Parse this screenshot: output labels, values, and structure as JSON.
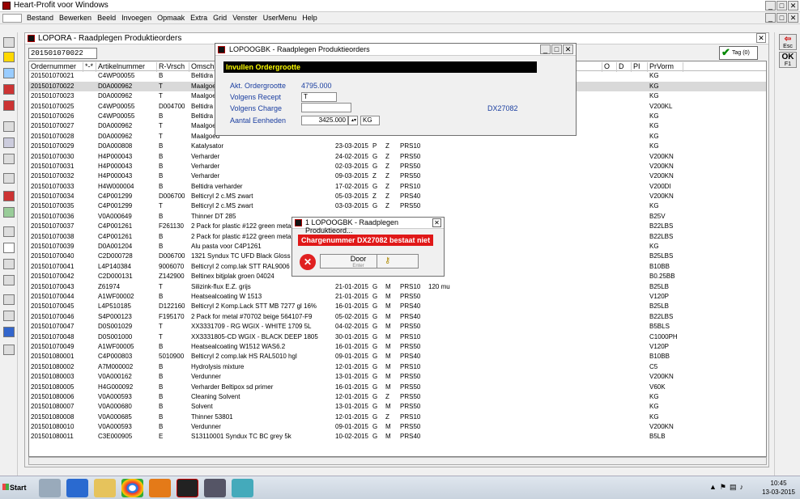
{
  "app": {
    "title": "Heart-Profit voor Windows"
  },
  "menu": [
    "Bestand",
    "Bewerken",
    "Beeld",
    "Invoegen",
    "Opmaak",
    "Extra",
    "Grid",
    "Venster",
    "UserMenu",
    "Help"
  ],
  "main": {
    "title": "LOPORA - Raadplegen Produktieorders",
    "search_value": "201501070022",
    "tag_label": "Tag (0)",
    "columns": [
      "Ordernummer",
      "*-*",
      "Artikelnummer",
      "R-Vrsch",
      "Omsch",
      "",
      "",
      "",
      "",
      "",
      "O",
      "D",
      "PI",
      "PrVorm"
    ],
    "rows": [
      [
        "201501070021",
        "",
        "C4WP00055",
        "B",
        "Beltidra 2",
        "",
        "",
        "",
        "",
        "",
        "",
        "",
        "",
        "KG"
      ],
      [
        "201501070022",
        "",
        "D0A000962",
        "T",
        "Maalgoed",
        "",
        "",
        "",
        "",
        "",
        "",
        "",
        "",
        "KG"
      ],
      [
        "201501070023",
        "",
        "D0A000962",
        "T",
        "Maalgoed",
        "",
        "",
        "",
        "",
        "",
        "",
        "",
        "",
        "KG"
      ],
      [
        "201501070025",
        "",
        "C4WP00055",
        "D004700",
        "Beltidra 2",
        "",
        "",
        "",
        "",
        "",
        "",
        "",
        "",
        "V200KL"
      ],
      [
        "201501070026",
        "",
        "C4WP00055",
        "B",
        "Beltidra 2",
        "",
        "",
        "",
        "",
        "",
        "",
        "",
        "",
        "KG"
      ],
      [
        "201501070027",
        "",
        "D0A000962",
        "T",
        "Maalgoed",
        "",
        "",
        "",
        "",
        "",
        "",
        "",
        "",
        "KG"
      ],
      [
        "201501070028",
        "",
        "D0A000962",
        "T",
        "Maalgoed",
        "",
        "",
        "",
        "",
        "",
        "",
        "",
        "",
        "KG"
      ],
      [
        "201501070029",
        "",
        "D0A000808",
        "B",
        "Katalysator",
        "23-03-2015",
        "P",
        "Z",
        "PRS10",
        "",
        "",
        "",
        "",
        "KG"
      ],
      [
        "201501070030",
        "",
        "H4P000043",
        "B",
        "Verharder",
        "24-02-2015",
        "G",
        "Z",
        "PRS50",
        "",
        "",
        "",
        "",
        "V200KN"
      ],
      [
        "201501070031",
        "",
        "H4P000043",
        "B",
        "Verharder",
        "02-03-2015",
        "G",
        "Z",
        "PRS50",
        "",
        "",
        "",
        "",
        "V200KN"
      ],
      [
        "201501070032",
        "",
        "H4P000043",
        "B",
        "Verharder",
        "09-03-2015",
        "Z",
        "Z",
        "PRS50",
        "",
        "",
        "",
        "",
        "V200KN"
      ],
      [
        "201501070033",
        "",
        "H4W000004",
        "B",
        "Beltidra verharder",
        "17-02-2015",
        "G",
        "Z",
        "PRS10",
        "",
        "",
        "",
        "",
        "V200DI"
      ],
      [
        "201501070034",
        "",
        "C4P001299",
        "D006700",
        "Belticryl 2 c.MS zwart",
        "05-03-2015",
        "Z",
        "Z",
        "PRS40",
        "",
        "",
        "",
        "",
        "V200KN"
      ],
      [
        "201501070035",
        "",
        "C4P001299",
        "T",
        "Belticryl 2 c.MS zwart",
        "03-03-2015",
        "G",
        "Z",
        "PRS50",
        "",
        "",
        "",
        "",
        "KG"
      ],
      [
        "201501070036",
        "",
        "V0A000649",
        "B",
        "Thinner DT 285",
        "",
        "",
        "",
        "",
        "",
        "",
        "",
        "",
        "B25V"
      ],
      [
        "201501070037",
        "",
        "C4P001261",
        "F261130",
        "2 Pack for plastic #122 green metal",
        "",
        "",
        "",
        "",
        "",
        "",
        "",
        "",
        "B22LBS"
      ],
      [
        "201501070038",
        "",
        "C4P001261",
        "B",
        "2 Pack for plastic #122 green metal",
        "",
        "",
        "",
        "",
        "",
        "",
        "",
        "",
        "B22LBS"
      ],
      [
        "201501070039",
        "",
        "D0A001204",
        "B",
        "Alu pasta voor C4P1261",
        "",
        "",
        "",
        "",
        "",
        "",
        "",
        "",
        "KG"
      ],
      [
        "201501070040",
        "",
        "C2D000728",
        "D006700",
        "1321 Syndux TC UFD Black Gloss 70%",
        "",
        "",
        "",
        "",
        "",
        "",
        "",
        "",
        "B25LBS"
      ],
      [
        "201501070041",
        "",
        "L4P140384",
        "9006070",
        "Belticryl 2 comp.lak STT RAL9006 gl5",
        "",
        "",
        "",
        "",
        "",
        "",
        "",
        "",
        "B10BB"
      ],
      [
        "201501070042",
        "",
        "C2D000131",
        "Z142900",
        "Beltinex bitjplak groen 04024",
        "",
        "",
        "",
        "",
        "",
        "",
        "",
        "",
        "B0.25BB"
      ],
      [
        "201501070043",
        "",
        "Z61974",
        "T",
        "Silizink-flux E.Z. grijs",
        "21-01-2015",
        "G",
        "M",
        "PRS10",
        "120 mu",
        "",
        "",
        "",
        "B25LB"
      ],
      [
        "201501070044",
        "",
        "A1WF00002",
        "B",
        "Heatsealcoating W 1513",
        "21-01-2015",
        "G",
        "M",
        "PRS50",
        "",
        "",
        "",
        "",
        "V120P"
      ],
      [
        "201501070045",
        "",
        "L4P510185",
        "D122160",
        "Belticryl 2 Komp.Lack STT MB 7277 gl 16%",
        "16-01-2015",
        "G",
        "M",
        "PRS40",
        "",
        "",
        "",
        "",
        "B25LB"
      ],
      [
        "201501070046",
        "",
        "S4P000123",
        "F195170",
        "2 Pack for metal #70702 beige 564107-F9",
        "05-02-2015",
        "G",
        "M",
        "PRS40",
        "",
        "",
        "",
        "",
        "B22LBS"
      ],
      [
        "201501070047",
        "",
        "D0S001029",
        "T",
        "XX3331709 - RG WGIX - WHITE 1709 5L",
        "04-02-2015",
        "G",
        "M",
        "PRS50",
        "",
        "",
        "",
        "",
        "B5BLS"
      ],
      [
        "201501070048",
        "",
        "D0S001000",
        "T",
        "XX3331805-CD WGIX - BLACK DEEP 1805",
        "30-01-2015",
        "G",
        "M",
        "PRS10",
        "",
        "",
        "",
        "",
        "C1000PH"
      ],
      [
        "201501070049",
        "",
        "A1WF00005",
        "B",
        "Heatsealcoating W1512 WAS6.2",
        "16-01-2015",
        "G",
        "M",
        "PRS50",
        "",
        "",
        "",
        "",
        "V120P"
      ],
      [
        "201501080001",
        "",
        "C4P000803",
        "5010900",
        "Belticryl 2 comp.lak HS RAL5010 hgl",
        "09-01-2015",
        "G",
        "M",
        "PRS40",
        "",
        "",
        "",
        "",
        "B10BB"
      ],
      [
        "201501080002",
        "",
        "A7M000002",
        "B",
        "Hydrolysis mixture",
        "12-01-2015",
        "G",
        "M",
        "PRS10",
        "",
        "",
        "",
        "",
        "C5"
      ],
      [
        "201501080003",
        "",
        "V0A000162",
        "B",
        "Verdunner",
        "13-01-2015",
        "G",
        "M",
        "PRS50",
        "",
        "",
        "",
        "",
        "V200KN"
      ],
      [
        "201501080005",
        "",
        "H4G000092",
        "B",
        "Verharder Beltipox sd primer",
        "16-01-2015",
        "G",
        "M",
        "PRS50",
        "",
        "",
        "",
        "",
        "V60K"
      ],
      [
        "201501080006",
        "",
        "V0A000593",
        "B",
        "Cleaning Solvent",
        "12-01-2015",
        "G",
        "Z",
        "PRS50",
        "",
        "",
        "",
        "",
        "KG"
      ],
      [
        "201501080007",
        "",
        "V0A000680",
        "B",
        "Solvent",
        "13-01-2015",
        "G",
        "M",
        "PRS50",
        "",
        "",
        "",
        "",
        "KG"
      ],
      [
        "201501080008",
        "",
        "V0A000685",
        "B",
        "Thinner 53801",
        "12-01-2015",
        "G",
        "Z",
        "PRS10",
        "",
        "",
        "",
        "",
        "KG"
      ],
      [
        "201501080010",
        "",
        "V0A000593",
        "B",
        "Verdunner",
        "09-01-2015",
        "G",
        "M",
        "PRS50",
        "",
        "",
        "",
        "",
        "V200KN"
      ],
      [
        "201501080011",
        "",
        "C3E000905",
        "E",
        "S13110001 Syndux TC BC grey 5k",
        "10-02-2015",
        "G",
        "M",
        "PRS40",
        "",
        "",
        "",
        "",
        "B5LB"
      ]
    ]
  },
  "order_dialog": {
    "title": "LOPOOGBK - Raadplegen Produktieorders",
    "banner": "Invullen Ordergrootte",
    "akt_label": "Akt. Ordergrootte",
    "akt_value": "4795.000",
    "recept_label": "Volgens Recept",
    "recept_value": "T",
    "charge_label": "Volgens Charge",
    "charge_value": "",
    "charge_code": "DX27082",
    "eenheden_label": "Aantal Eenheden",
    "eenheden_value": "3425.000",
    "unit_value": "KG"
  },
  "error_dialog": {
    "title": "1 LOPOOGBK - Raadplegen Produktieord...",
    "message": "Chargenummer DX27082 bestaat niet",
    "door_label": "Door",
    "door_sub": "Enter"
  },
  "right_toolbar": {
    "esc_label": "Esc",
    "ok_label": "OK",
    "f1_label": "F1"
  },
  "taskbar": {
    "start": "Start",
    "time": "10:45",
    "date": "13-03-2015"
  }
}
